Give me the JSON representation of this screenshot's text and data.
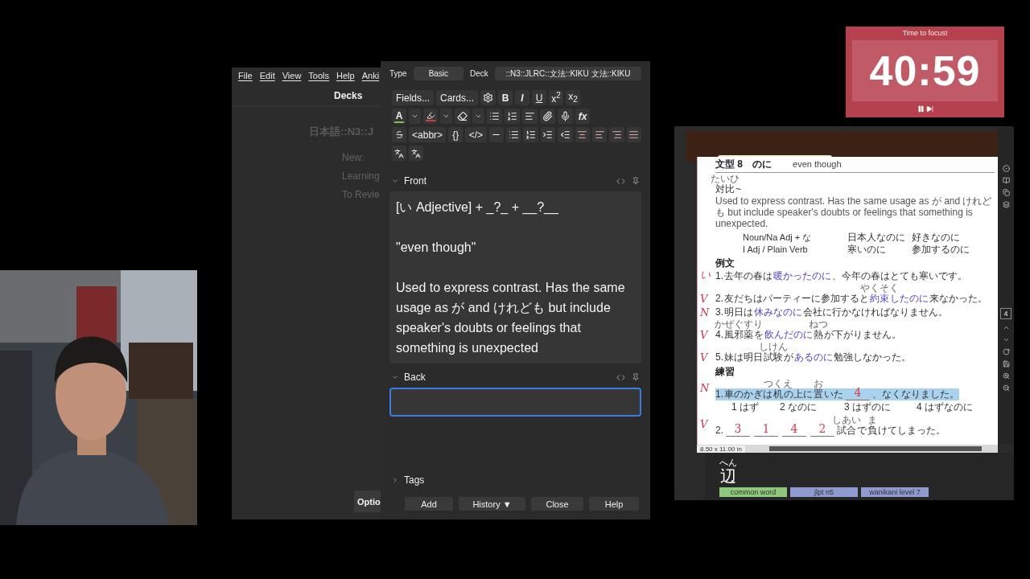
{
  "anki_main": {
    "menu": [
      "File",
      "Edit",
      "View",
      "Tools",
      "Help",
      "Anki"
    ],
    "title": "Decks",
    "deck": "日本語::N3::J",
    "stats": [
      "New:",
      "Learning",
      "To Revie"
    ],
    "options_button": "Optio"
  },
  "add_dialog": {
    "type_label": "Type",
    "note_type": "Basic",
    "deck_label": "Deck",
    "deck": "::N3::JLRC::文法::KIKU 文法::KIKU",
    "toolbar": [
      [
        {
          "kind": "text",
          "label": "Fields..."
        },
        {
          "kind": "text",
          "label": "Cards..."
        },
        {
          "kind": "gear"
        },
        {
          "kind": "bold",
          "label": "B"
        },
        {
          "kind": "italic",
          "label": "I"
        },
        {
          "kind": "underline",
          "label": "U"
        },
        {
          "kind": "script",
          "label": "x$^{2}$"
        },
        {
          "kind": "script",
          "label": "x$_{2}$"
        }
      ],
      [
        {
          "kind": "text-color",
          "label": "A"
        },
        {
          "kind": "caret"
        },
        {
          "kind": "highlight"
        },
        {
          "kind": "caret"
        },
        {
          "kind": "eraser"
        },
        {
          "kind": "caret"
        },
        {
          "kind": "bullets"
        },
        {
          "kind": "numbers"
        },
        {
          "kind": "lines"
        },
        {
          "kind": "clip"
        },
        {
          "kind": "mic"
        },
        {
          "kind": "italic",
          "label": "fx"
        }
      ],
      [
        {
          "kind": "strike"
        },
        {
          "kind": "text",
          "label": "<abbr>"
        },
        {
          "kind": "text",
          "label": "{}"
        },
        {
          "kind": "text",
          "label": "</>"
        },
        {
          "kind": "rule"
        },
        {
          "kind": "bullets"
        },
        {
          "kind": "numbers"
        },
        {
          "kind": "indent"
        },
        {
          "kind": "outdent"
        },
        {
          "kind": "center"
        },
        {
          "kind": "left"
        },
        {
          "kind": "right"
        },
        {
          "kind": "justify"
        }
      ],
      [
        {
          "kind": "ruby"
        },
        {
          "kind": "ruby"
        }
      ]
    ],
    "fields": [
      {
        "name": "Front",
        "expanded": true,
        "focused": false,
        "paragraphs": [
          "[い Adjective] + _?_ + __?__",
          "\"even though\"",
          "Used to express contrast. Has the same usage as が and けれども but include speaker's doubts or feelings that something is unexpected"
        ]
      },
      {
        "name": "Back",
        "expanded": true,
        "focused": true
      }
    ],
    "tags": {
      "label": "Tags",
      "expanded": false
    },
    "buttons": [
      "Add",
      "History ▼",
      "Close",
      "Help"
    ]
  },
  "timer": {
    "title": "Time to focus!",
    "time": "40:59",
    "running": true
  },
  "pdf_viewer": {
    "page_size": "8.50 x 11.00 in",
    "page_number": "4",
    "document": {
      "heading": "文型 8　のに",
      "heading_gloss": "even though",
      "topic": "対比",
      "topic_ruby": "たいひ",
      "topic_suffix": "~",
      "description": "Used to express contrast. Has the same usage as が and けれども but include speaker's doubts or feelings that something is unexpected.",
      "patterns": [
        [
          "Noun/Na Adj + な",
          "日本人なのに",
          "好きなのに"
        ],
        [
          "I Adj /  Plain Verb",
          "寒いのに",
          "参加するのに"
        ]
      ],
      "examples_title": "例文",
      "examples": [
        {
          "mark": "い",
          "number": "1.",
          "segments": [
            {
              "t": "去年の春は",
              "target": false
            },
            {
              "t": "暖かったのに",
              "target": true
            },
            {
              "t": "、今年の春はとても寒いです。",
              "target": false
            }
          ]
        },
        {
          "mark": "V",
          "number": "2.",
          "segments": [
            {
              "t": "友だちはパーティーに参加すると",
              "target": false
            },
            {
              "t": "約束",
              "ruby": "やくそく",
              "target": true
            },
            {
              "t": "したのに",
              "target": true
            },
            {
              "t": "来なかった。",
              "target": false
            }
          ]
        },
        {
          "mark": "N",
          "number": "3.",
          "segments": [
            {
              "t": "明日は",
              "target": false
            },
            {
              "t": "休みなのに",
              "target": true
            },
            {
              "t": "会社に行かなければなりません。",
              "target": false
            }
          ]
        },
        {
          "mark": "V",
          "number": "4.",
          "segments": [
            {
              "t": "風邪薬",
              "ruby": "かぜぐすり",
              "target": false
            },
            {
              "t": "を",
              "target": false
            },
            {
              "t": "飲んだのに",
              "target": true
            },
            {
              "t": "熱",
              "ruby": "ねつ",
              "target": false
            },
            {
              "t": "が下がりません。",
              "target": false
            }
          ]
        },
        {
          "mark": "V",
          "number": "5.",
          "segments": [
            {
              "t": "妹は明日",
              "target": false
            },
            {
              "t": "試験",
              "ruby": "しけん",
              "target": false
            },
            {
              "t": "が",
              "target": false
            },
            {
              "t": "あるのに",
              "target": true
            },
            {
              "t": "勉強しなかった。",
              "target": false
            }
          ]
        }
      ],
      "practice_title": "練習",
      "practice": [
        {
          "mark": "N",
          "number": "1.",
          "selected": true,
          "segments": [
            {
              "kind": "text",
              "t": "車のかぎは"
            },
            {
              "kind": "text",
              "t": "机",
              "ruby": "つくえ"
            },
            {
              "kind": "text",
              "t": "の上に"
            },
            {
              "kind": "text",
              "t": "置",
              "ruby": "お"
            },
            {
              "kind": "text",
              "t": "いた"
            },
            {
              "kind": "blank",
              "answer": "4"
            },
            {
              "kind": "text",
              "t": "、なくなりました。"
            }
          ],
          "options": [
            "1 はず",
            "2 なのに",
            "3 はずのに",
            "4 はずなのに"
          ]
        },
        {
          "mark": "V",
          "number": "2.",
          "selected": false,
          "segments": [
            {
              "kind": "blank",
              "answer": "3"
            },
            {
              "kind": "blank",
              "answer": "1"
            },
            {
              "kind": "blank",
              "answer": "4"
            },
            {
              "kind": "blank",
              "answer": "2"
            },
            {
              "kind": "text",
              "t": "試合",
              "ruby": "しあい"
            },
            {
              "kind": "text",
              "t": "で"
            },
            {
              "kind": "text",
              "t": "負",
              "ruby": "ま"
            },
            {
              "kind": "text",
              "t": "けてしまった。"
            }
          ]
        }
      ]
    }
  },
  "dictionary": {
    "reading": "へん",
    "word": "辺",
    "tags": [
      {
        "label": "common word",
        "color": "#8cc97a"
      },
      {
        "label": "jlpt n5",
        "color": "#8f9ad0"
      },
      {
        "label": "wanikani level 7",
        "color": "#8f9ad0"
      }
    ]
  }
}
